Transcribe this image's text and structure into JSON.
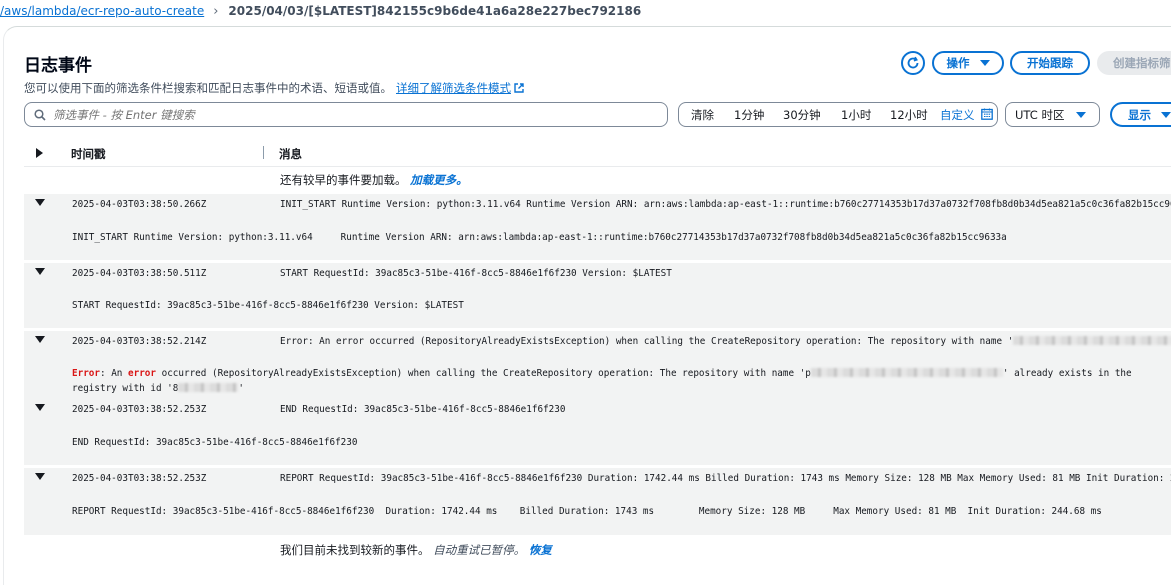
{
  "breadcrumb": {
    "parent": "/aws/lambda/ecr-repo-auto-create",
    "current": "2025/04/03/[$LATEST]842155c9b6de41a6a28e227bec792186"
  },
  "header": {
    "title": "日志事件",
    "subtitle": "您可以使用下面的筛选条件栏搜索和匹配日志事件中的术语、短语或值。",
    "learn_more": "详细了解筛选条件模式",
    "actions_label": "操作",
    "tail_label": "开始跟踪",
    "create_metric_label": "创建指标筛"
  },
  "filter": {
    "placeholder": "筛选事件 - 按 Enter 键搜索"
  },
  "time_range": {
    "clear": "清除",
    "m1": "1分钟",
    "m30": "30分钟",
    "h1": "1小时",
    "h12": "12小时",
    "custom": "自定义"
  },
  "timezone": {
    "label": "UTC 时区"
  },
  "display": {
    "label": "显示"
  },
  "table": {
    "col_time": "时间戳",
    "col_message": "消息"
  },
  "top_notice": {
    "text": "还有较早的事件要加载。",
    "link": "加载更多。"
  },
  "bottom_notice": {
    "text": "我们目前未找到较新的事件。",
    "italic": "自动重试已暂停。",
    "link": "恢复"
  },
  "events": [
    {
      "timestamp": "2025-04-03T03:38:50.266Z",
      "message": "INIT_START Runtime Version: python:3.11.v64 Runtime Version ARN: arn:aws:lambda:ap-east-1::runtime:b760c27714353b17d37a0732f708fb8d0b34d5ea821a5c0c36fa82b15cc9633a",
      "detail": "INIT_START Runtime Version: python:3.11.v64     Runtime Version ARN: arn:aws:lambda:ap-east-1::runtime:b760c27714353b17d37a0732f708fb8d0b34d5ea821a5c0c36fa82b15cc9633a"
    },
    {
      "timestamp": "2025-04-03T03:38:50.511Z",
      "message": "START RequestId: 39ac85c3-51be-416f-8cc5-8846e1f6f230 Version: $LATEST",
      "detail": "START RequestId: 39ac85c3-51be-416f-8cc5-8846e1f6f230 Version: $LATEST"
    },
    {
      "timestamp": "2025-04-03T03:38:52.214Z",
      "message": "Error: An error occurred (RepositoryAlreadyExistsException) when calling the CreateRepository operation: The repository with name '",
      "detail_error_word": "Error",
      "detail_a": ": An ",
      "detail_error_word2": "error",
      "detail_b": " occurred (RepositoryAlreadyExistsException) when calling the CreateRepository operation: The repository with name 'p",
      "detail_c": "' already exists in the",
      "detail_line2": "registry with id '8",
      "detail_line2_end": "'"
    },
    {
      "timestamp": "2025-04-03T03:38:52.253Z",
      "message": "END RequestId: 39ac85c3-51be-416f-8cc5-8846e1f6f230",
      "detail": "END RequestId: 39ac85c3-51be-416f-8cc5-8846e1f6f230"
    },
    {
      "timestamp": "2025-04-03T03:38:52.253Z",
      "message": "REPORT RequestId: 39ac85c3-51be-416f-8cc5-8846e1f6f230 Duration: 1742.44 ms Billed Duration: 1743 ms Memory Size: 128 MB Max Memory Used: 81 MB Init Duration: 244.68 ms",
      "detail": "REPORT RequestId: 39ac85c3-51be-416f-8cc5-8846e1f6f230  Duration: 1742.44 ms    Billed Duration: 1743 ms        Memory Size: 128 MB     Max Memory Used: 81 MB  Init Duration: 244.68 ms"
    }
  ]
}
